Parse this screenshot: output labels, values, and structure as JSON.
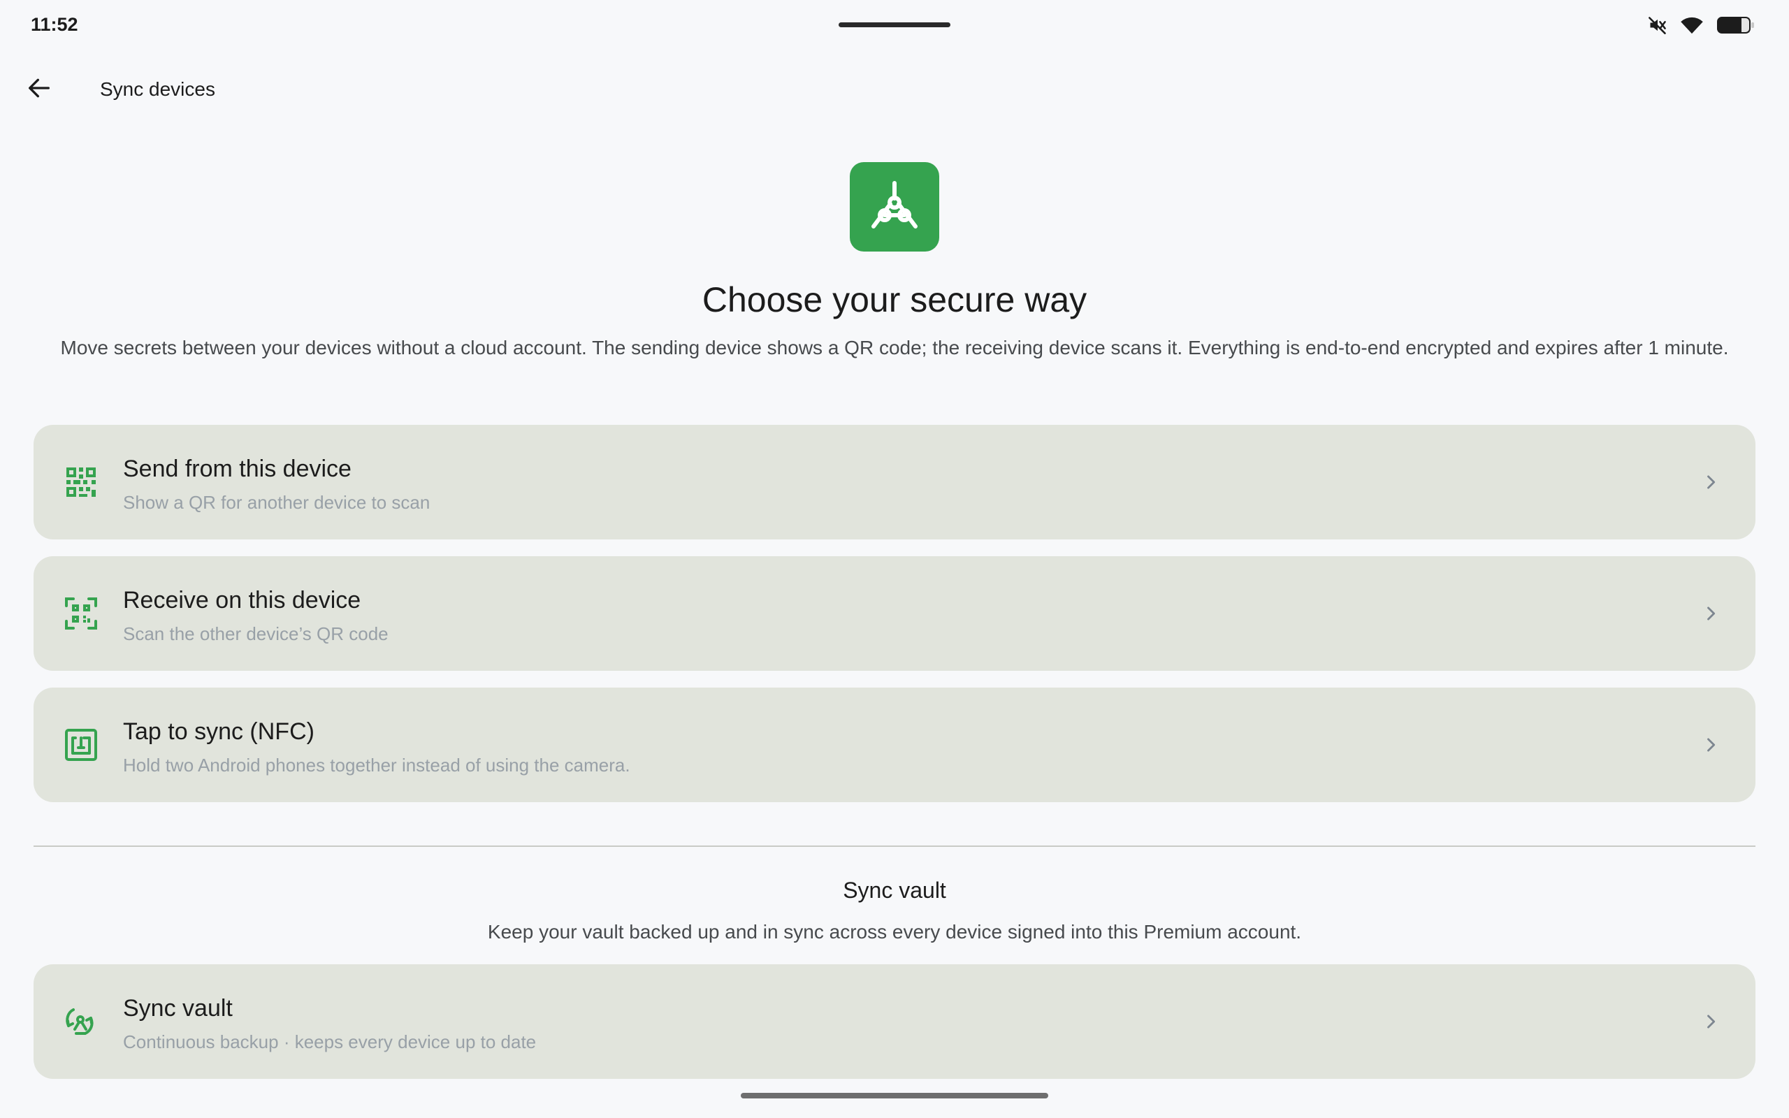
{
  "status_bar": {
    "time": "11:52",
    "icons": [
      "mute-icon",
      "wifi-icon",
      "battery-icon"
    ]
  },
  "app_bar": {
    "back_icon": "arrow-back-icon",
    "title": "Sync devices"
  },
  "hero": {
    "logo_icon": "network-hub-icon",
    "title": "Choose your secure way",
    "description": "Move secrets between your devices without a cloud account. The sending device shows a QR code; the receiving device scans it. Everything is end-to-end encrypted and expires after 1 minute."
  },
  "options": [
    {
      "icon": "qr-code-icon",
      "title": "Send from this device",
      "subtitle": "Show a QR for another device to scan"
    },
    {
      "icon": "qr-scan-icon",
      "title": "Receive on this device",
      "subtitle": "Scan the other device’s QR code"
    },
    {
      "icon": "nfc-icon",
      "title": "Tap to sync (NFC)",
      "subtitle": "Hold two Android phones together instead of using the camera."
    }
  ],
  "sync_section": {
    "title": "Sync vault",
    "description": "Keep your vault backed up and in sync across every device signed into this Premium account.",
    "card": {
      "icon": "sync-icon",
      "title": "Sync vault",
      "subtitle": "Continuous backup · keeps every device up to date"
    }
  },
  "colors": {
    "accent_green": "#35a34f",
    "card_background": "#e1e4dc",
    "page_background": "#f7f8fa",
    "subtitle_text": "#98a0a7"
  }
}
